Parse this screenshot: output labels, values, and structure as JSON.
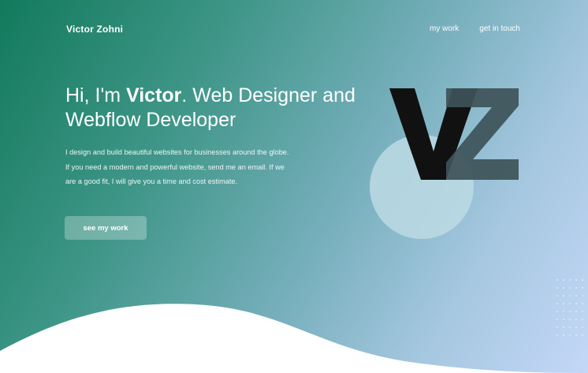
{
  "nav": {
    "brand": "Victor Zohni",
    "links": [
      "my work",
      "get in touch"
    ]
  },
  "hero": {
    "greeting": "Hi, I'm ",
    "name": "Victor",
    "title_rest": ". Web Designer and Webflow Developer",
    "description_lines": [
      "I design and build beautiful websites for businesses around the globe.",
      "If you need a modern and powerful website, send me an email. If we",
      "are a good fit, I will give you a time and cost estimate."
    ],
    "cta_label": "see my work"
  },
  "logo_mark": {
    "letters": "VZ",
    "icon": "vz-monogram-icon",
    "colors": {
      "v": "#111111",
      "z": "#3d5358",
      "circle": "#bcdbe4"
    }
  },
  "theme": {
    "gradient_start": "#127a5c",
    "gradient_end": "#c4d7f7",
    "wave": "#ffffff"
  }
}
